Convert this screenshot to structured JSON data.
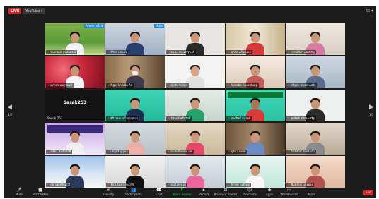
{
  "topbar": {
    "live_label": "LIVE",
    "youtube_label": "YouTube ▾",
    "view_label": "⊞ ▾"
  },
  "navigation": {
    "prev_arrow": "◀",
    "next_arrow": "▶",
    "page_left": "1/2",
    "page_right": "1/2"
  },
  "tiles": [
    {
      "name": "ชนกนันท์ สุขสมบูรณ์",
      "tag": "Ace-Ar ×1.4",
      "muted": true
    },
    {
      "name": "ศิริพร ผลนคร",
      "tag": "Mute",
      "muted": true
    },
    {
      "name": "ธนพล ประเสริฐวงศ์",
      "tag": "",
      "muted": true
    },
    {
      "name": "ศุภกิต แก้วมงคล",
      "tag": "",
      "muted": true
    },
    {
      "name": "วรรณ์วิภา แสงหิรัญ",
      "tag": "",
      "muted": true
    },
    {
      "name": "ศุภาพร มหาจันทร์",
      "tag": "",
      "muted": true
    },
    {
      "name": "Nguyễn Văn An",
      "tag": "",
      "muted": true
    },
    {
      "name": "ศุภชัย รักสกุล",
      "tag": "",
      "muted": true
    },
    {
      "name": "Ajaraba Rosenburg",
      "tag": "",
      "muted": true
    },
    {
      "name": "ศรีสุดา ทองประเสริฐ",
      "tag": "",
      "muted": true
    },
    {
      "name": "Sanuk 253",
      "title": "Sasak253",
      "tag": "",
      "muted": false
    },
    {
      "name": "ศิริวรรณ แก้วกาญจนา",
      "tag": "",
      "muted": true
    },
    {
      "name": "นิรันดร์ ศรีสวัสดิ์",
      "tag": "",
      "muted": true
    },
    {
      "name": "ประสิทธิ์ สมวงศ์",
      "tag": "",
      "muted": true
    },
    {
      "name": "พรทิพย์ ศรีประเสริฐ",
      "tag": "",
      "muted": true
    },
    {
      "name": "ชลิตา พิมพ์สวัสดิ์",
      "tag": "",
      "muted": true
    },
    {
      "name": "เพ็ญศรี บุญมา",
      "tag": "",
      "muted": true
    },
    {
      "name": "สมศักดิ์ พรหมวงศ์",
      "tag": "",
      "muted": true
    },
    {
      "name": "ชุติมา ทองดี",
      "tag": "",
      "muted": true
    },
    {
      "name": "กิตติศักดิ์ จันทร์แก้ว",
      "tag": "",
      "muted": true
    },
    {
      "name": "ณัฐวุฒิ ศรีสมบัติ",
      "tag": "",
      "muted": true
    },
    {
      "name": "รัชนี อินทรประเสริฐ",
      "tag": "",
      "muted": true
    },
    {
      "name": "อรุณี พรมมา",
      "tag": "",
      "muted": true
    },
    {
      "name": "จิราพร วงศ์ไทย",
      "tag": "",
      "muted": true
    },
    {
      "name": "พิมพ์ชนก แสงทอง",
      "tag": "",
      "muted": true
    }
  ],
  "toolbar": {
    "items": [
      {
        "icon": "🎤",
        "label": "Mute"
      },
      {
        "icon": "■",
        "label": "Start Video"
      },
      {
        "icon": "⛨",
        "label": "Security"
      },
      {
        "icon": "👥",
        "label": "Participants"
      },
      {
        "icon": "💬",
        "label": "Chat"
      },
      {
        "icon": "⬆",
        "label": "Share Screen"
      },
      {
        "icon": "⏺",
        "label": "Record"
      },
      {
        "icon": "⊞",
        "label": "Breakout Rooms"
      },
      {
        "icon": "☺",
        "label": "Reactions"
      },
      {
        "icon": "✚",
        "label": "Apps"
      },
      {
        "icon": "▭",
        "label": "Whiteboards"
      },
      {
        "icon": "…",
        "label": "More"
      }
    ],
    "end_label": "End"
  },
  "colors": {
    "window_bg": "#1c1c1c",
    "live_red": "#d92b2b",
    "share_green": "#2ecc4a",
    "tag_blue": "#2a8ad8"
  }
}
